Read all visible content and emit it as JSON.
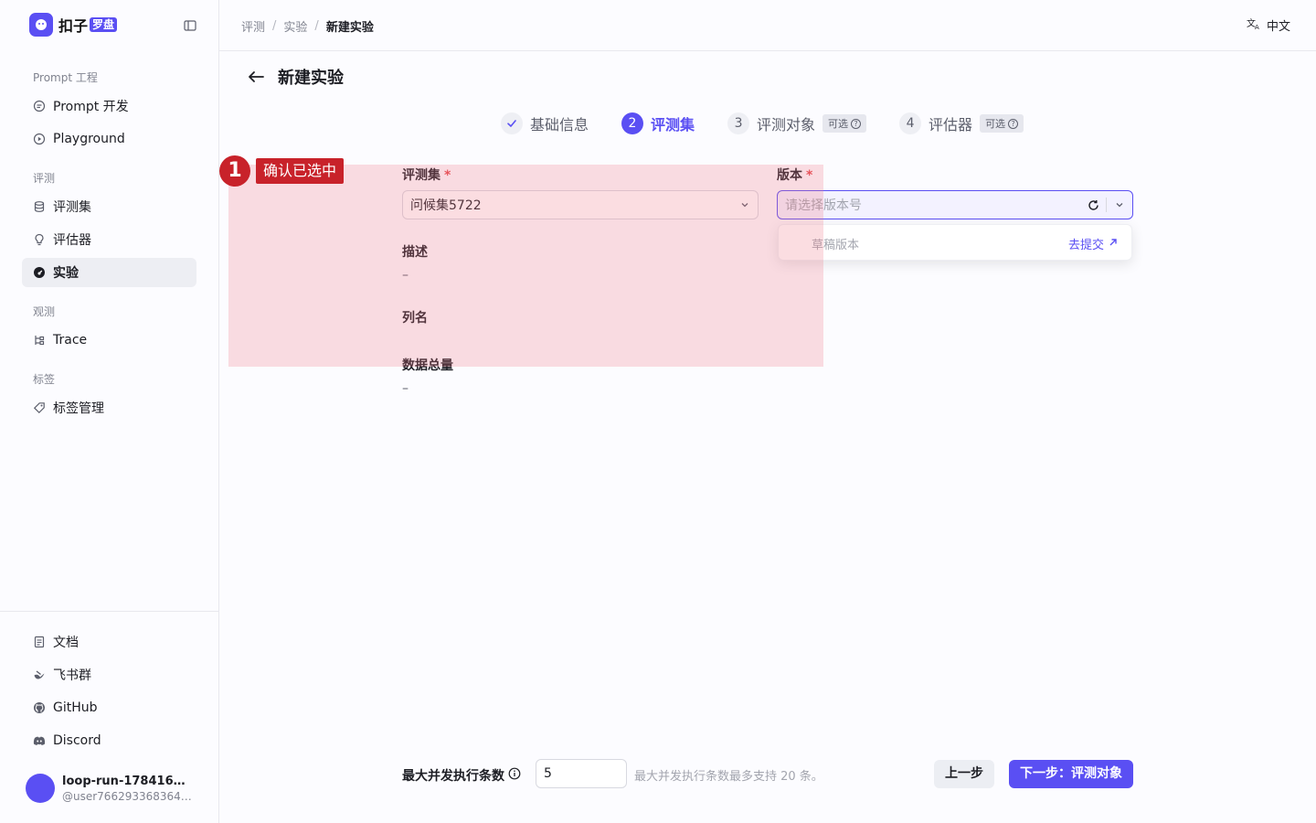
{
  "app": {
    "logo_text": "扣子",
    "logo_badge": "罗盘"
  },
  "sidebar": {
    "groups": [
      {
        "title": "Prompt 工程",
        "items": [
          {
            "label": "Prompt 开发",
            "icon": "prompt-icon"
          },
          {
            "label": "Playground",
            "icon": "play-icon"
          }
        ]
      },
      {
        "title": "评测",
        "items": [
          {
            "label": "评测集",
            "icon": "database-icon"
          },
          {
            "label": "评估器",
            "icon": "bulb-icon"
          },
          {
            "label": "实验",
            "icon": "gauge-icon",
            "active": true
          }
        ]
      },
      {
        "title": "观测",
        "items": [
          {
            "label": "Trace",
            "icon": "trace-icon"
          }
        ]
      },
      {
        "title": "标签",
        "items": [
          {
            "label": "标签管理",
            "icon": "tag-icon"
          }
        ]
      }
    ],
    "bottom": [
      {
        "label": "文档",
        "icon": "doc-icon"
      },
      {
        "label": "飞书群",
        "icon": "lark-icon"
      },
      {
        "label": "GitHub",
        "icon": "github-icon"
      },
      {
        "label": "Discord",
        "icon": "discord-icon"
      }
    ],
    "user": {
      "name": "loop-run-178416577...",
      "id": "@user7662933683648..."
    }
  },
  "topbar": {
    "breadcrumbs": [
      "评测",
      "实验",
      "新建实验"
    ],
    "language": "中文"
  },
  "page": {
    "title": "新建实验"
  },
  "steps": [
    {
      "num": "✓",
      "label": "基础信息",
      "done": true
    },
    {
      "num": "2",
      "label": "评测集",
      "active": true
    },
    {
      "num": "3",
      "label": "评测对象",
      "tag": "可选"
    },
    {
      "num": "4",
      "label": "评估器",
      "tag": "可选"
    }
  ],
  "annotation": {
    "number": "1",
    "label": "确认已选中"
  },
  "form": {
    "dataset_label": "评测集",
    "dataset_value": "问候集5722",
    "version_label": "版本",
    "version_placeholder": "请选择版本号",
    "dropdown": {
      "draft": "草稿版本",
      "submit_link": "去提交"
    },
    "desc_label": "描述",
    "desc_value": "–",
    "columns_label": "列名",
    "total_label": "数据总量",
    "total_value": "–"
  },
  "footer": {
    "max_label": "最大并发执行条数",
    "max_value": "5",
    "hint": "最大并发执行条数最多支持 20 条。",
    "prev": "上一步",
    "next": "下一步：评测对象"
  },
  "colors": {
    "accent": "#5a4ff3",
    "annotation": "#c8222a",
    "required": "#e5484d"
  }
}
